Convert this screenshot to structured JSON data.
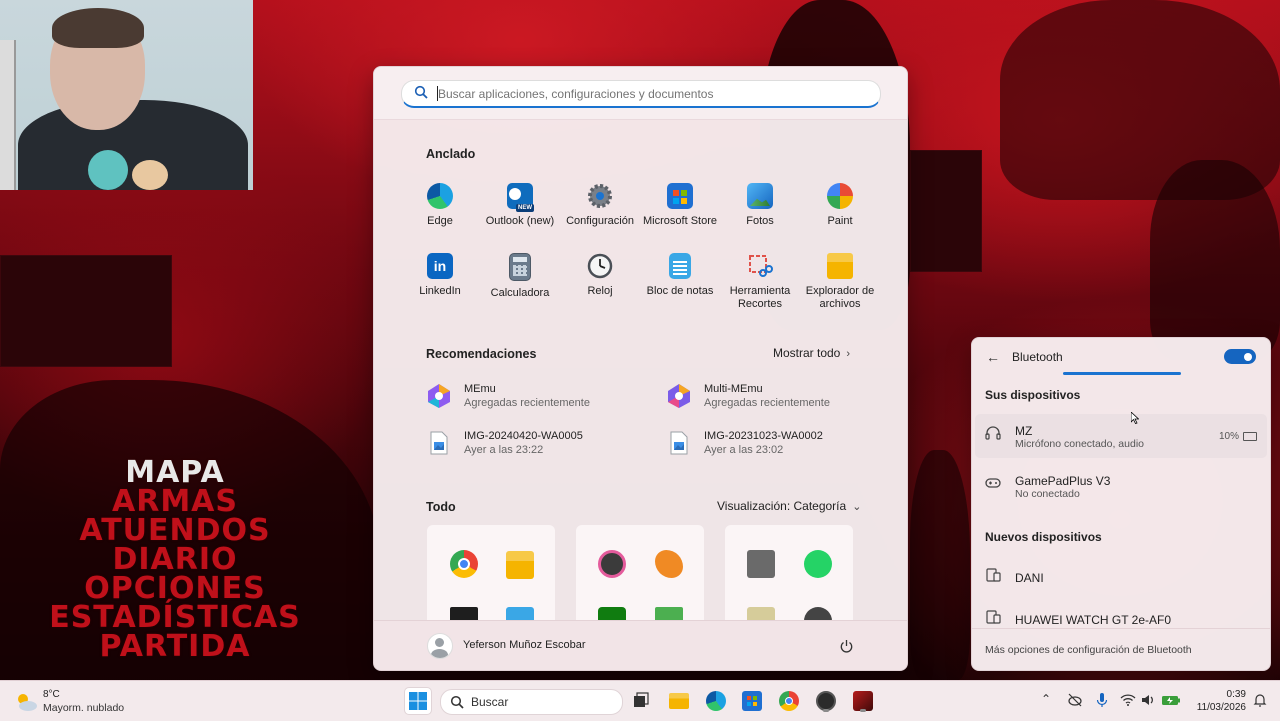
{
  "start_menu": {
    "search_placeholder": "Buscar aplicaciones, configuraciones y documentos",
    "pinned_title": "Anclado",
    "pinned": [
      {
        "label": "Edge",
        "icon": "edge-icon"
      },
      {
        "label": "Outlook (new)",
        "icon": "outlook-icon"
      },
      {
        "label": "Configuración",
        "icon": "settings-gear-icon"
      },
      {
        "label": "Microsoft Store",
        "icon": "store-icon"
      },
      {
        "label": "Fotos",
        "icon": "photos-icon"
      },
      {
        "label": "Paint",
        "icon": "paint-icon"
      },
      {
        "label": "LinkedIn",
        "icon": "linkedin-icon"
      },
      {
        "label": "Calculadora",
        "icon": "calculator-icon"
      },
      {
        "label": "Reloj",
        "icon": "clock-icon"
      },
      {
        "label": "Bloc de notas",
        "icon": "notepad-icon"
      },
      {
        "label": "Herramienta Recortes",
        "icon": "snipping-tool-icon"
      },
      {
        "label": "Explorador de archivos",
        "icon": "folder-icon"
      }
    ],
    "outlook_badge": "NEW",
    "recommended_title": "Recomendaciones",
    "show_all": "Mostrar todo",
    "recommended": [
      {
        "name": "MEmu",
        "sub": "Agregadas recientemente",
        "icon": "memu-icon"
      },
      {
        "name": "Multi-MEmu",
        "sub": "Agregadas recientemente",
        "icon": "multi-memu-icon"
      },
      {
        "name": "IMG-20240420-WA0005",
        "sub": "Ayer a las 23:22",
        "icon": "image-file-icon"
      },
      {
        "name": "IMG-20231023-WA0002",
        "sub": "Ayer a las 23:02",
        "icon": "image-file-icon"
      }
    ],
    "all_title": "Todo",
    "view_label": "Visualización: Categoría",
    "user_name": "Yeferson Muñoz Escobar"
  },
  "bluetooth": {
    "title": "Bluetooth",
    "toggle_on": true,
    "your_devices": "Sus dispositivos",
    "devices": [
      {
        "name": "MZ",
        "status": "Micrófono conectado, audio",
        "battery": "10%",
        "icon": "headset-icon"
      },
      {
        "name": "GamePadPlus V3",
        "status": "No conectado",
        "icon": "gamepad-icon"
      }
    ],
    "new_devices": "Nuevos dispositivos",
    "new": [
      {
        "name": "DANI",
        "icon": "device-icon"
      },
      {
        "name": "HUAWEI WATCH GT 2e-AF0",
        "icon": "device-icon"
      }
    ],
    "more_options": "Más opciones de configuración de Bluetooth"
  },
  "game_menu": [
    "Mapa",
    "Armas",
    "Atuendos",
    "Diario",
    "Opciones",
    "Estadísticas",
    "Partida"
  ],
  "taskbar": {
    "weather_temp": "8°C",
    "weather_desc": "Mayorm. nublado",
    "search_label": "Buscar",
    "time": "0:39",
    "date": "11/03/2026"
  },
  "colors": {
    "accent": "#1a73d0",
    "wallpaper_red": "#c0101a"
  }
}
